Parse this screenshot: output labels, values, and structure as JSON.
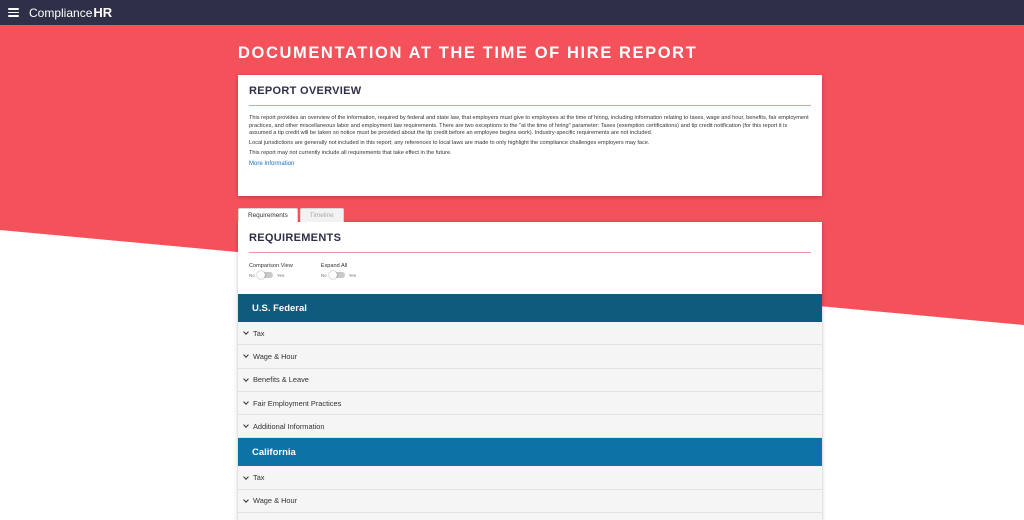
{
  "app": {
    "logo_prefix": "Compliance",
    "logo_suffix": "HR"
  },
  "page": {
    "title": "DOCUMENTATION AT THE TIME OF HIRE REPORT"
  },
  "overview": {
    "heading": "REPORT OVERVIEW",
    "paragraphs": [
      "This report provides an overview of the information, required by federal and state law, that employers must give to employees at the time of hiring, including information relating to taxes, wage and hour, benefits, fair employment practices, and other miscellaneous labor and employment law requirements. There are two exceptions to the \"at the time of hiring\" parameter: Taxes (exemption certifications) and tip credit notification (for this report it is assumed a tip credit will be taken so notice must be provided about the tip credit before an employee begins work). Industry-specific requirements are not included.",
      "Local jurisdictions are generally not included in this report; any references to local laws are made to only highlight the compliance challenges employers may face.",
      "This report may not currently include all requirements that take effect in the future."
    ],
    "more_link": "More Information"
  },
  "tabs": [
    {
      "label": "Requirements",
      "active": true
    },
    {
      "label": "Timeline",
      "active": false
    }
  ],
  "requirements": {
    "heading": "REQUIREMENTS",
    "toggles": [
      {
        "label": "Comparison View",
        "off": "No",
        "on": "Yes",
        "value": false
      },
      {
        "label": "Expand All",
        "off": "No",
        "on": "Yes",
        "value": false
      }
    ],
    "sections": [
      {
        "name": "U.S. Federal",
        "color": "#0f5b7e",
        "rows": [
          "Tax",
          "Wage & Hour",
          "Benefits & Leave",
          "Fair Employment Practices",
          "Additional Information"
        ]
      },
      {
        "name": "California",
        "color": "#0d72a6",
        "rows": [
          "Tax",
          "Wage & Hour"
        ]
      }
    ]
  },
  "colors": {
    "accent_red": "#f4515b",
    "topbar": "#2e3048",
    "link": "#1a73c4"
  }
}
